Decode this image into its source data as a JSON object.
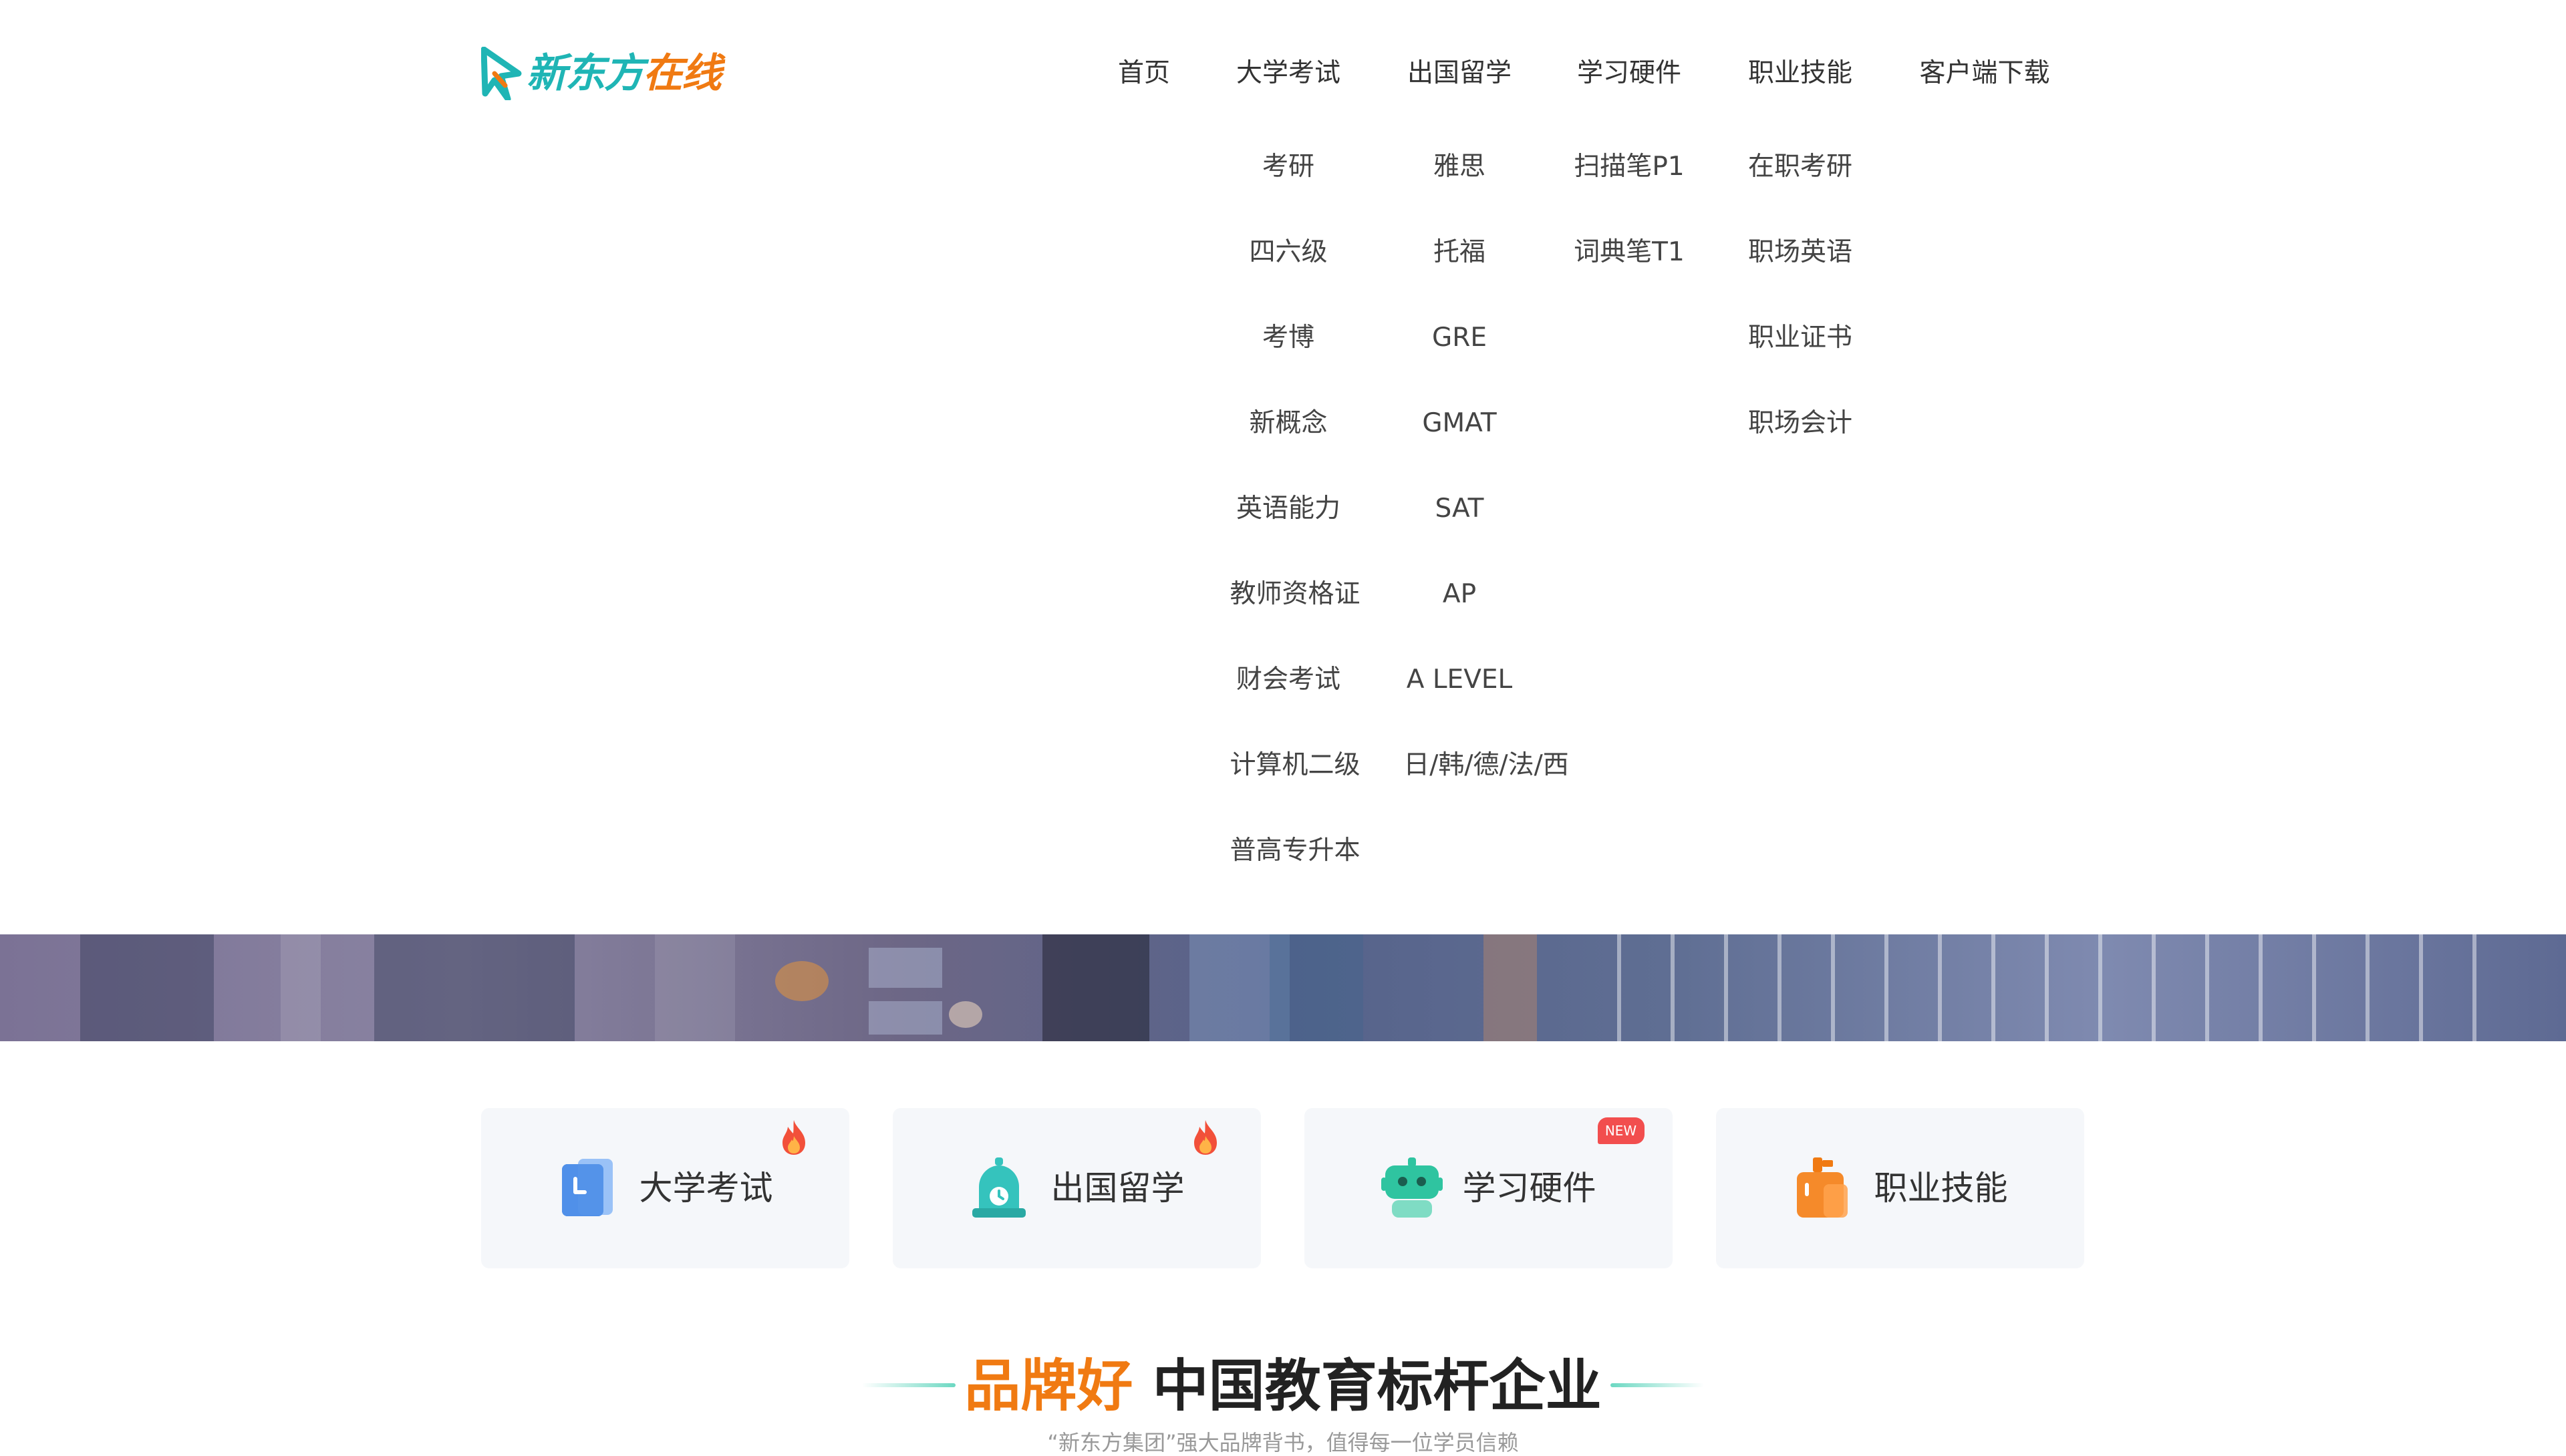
{
  "brand": {
    "logo_text_part1": "新东方",
    "logo_text_part2": "在线",
    "color_teal": "#1fb5b5",
    "color_orange": "#f07a12"
  },
  "nav": {
    "items": [
      "首页",
      "大学考试",
      "出国留学",
      "学习硬件",
      "职业技能",
      "客户端下载"
    ]
  },
  "submenus": {
    "college_exams": [
      "考研",
      "四六级",
      "考博",
      "新概念",
      "英语能力",
      "教师资格证",
      "财会考试",
      "计算机二级",
      "普高专升本"
    ],
    "study_abroad": [
      "雅思",
      "托福",
      "GRE",
      "GMAT",
      "SAT",
      "AP",
      "A LEVEL",
      "日/韩/德/法/西"
    ],
    "hardware": [
      "扫描笔P1",
      "词典笔T1"
    ],
    "career": [
      "在职考研",
      "职场英语",
      "职业证书",
      "职场会计"
    ]
  },
  "cards": [
    {
      "label": "大学考试",
      "icon": "book-icon",
      "badge": "fire-icon"
    },
    {
      "label": "出国留学",
      "icon": "bell-clock-icon",
      "badge": "fire-icon"
    },
    {
      "label": "学习硬件",
      "icon": "robot-icon",
      "badge_text": "NEW"
    },
    {
      "label": "职业技能",
      "icon": "briefcase-icon"
    }
  ],
  "section": {
    "title_highlight": "品牌好",
    "title_rest": "中国教育标杆企业",
    "subtitle": "“新东方集团”强大品牌背书，值得每一位学员信赖"
  }
}
